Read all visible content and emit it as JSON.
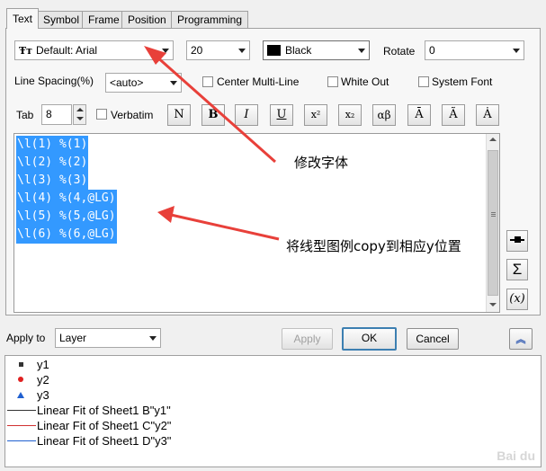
{
  "tabs": [
    {
      "label": "Text",
      "active": true
    },
    {
      "label": "Symbol",
      "active": false
    },
    {
      "label": "Frame",
      "active": false
    },
    {
      "label": "Position",
      "active": false
    },
    {
      "label": "Programming",
      "active": false
    }
  ],
  "font": {
    "icon": "truetype-font-icon",
    "value": "Default: Arial"
  },
  "size": {
    "value": "20"
  },
  "color": {
    "value": "Black",
    "swatch": "#000000"
  },
  "rotate": {
    "label": "Rotate",
    "value": "0"
  },
  "line_spacing": {
    "label": "Line Spacing(%)",
    "value": "<auto>"
  },
  "center_multiline": {
    "label": "Center Multi-Line",
    "checked": false
  },
  "white_out": {
    "label": "White Out",
    "checked": false
  },
  "system_font": {
    "label": "System Font",
    "checked": false
  },
  "tab": {
    "label": "Tab",
    "value": "8"
  },
  "verbatim": {
    "label": "Verbatim",
    "checked": false
  },
  "format_buttons": [
    "N",
    "B",
    "I",
    "U",
    "x²",
    "x₂",
    "αβ",
    "Ā",
    "Ã",
    "Ȧ"
  ],
  "editor_lines": [
    "\\l(1) %(1)",
    "\\l(2) %(2)",
    "\\l(3) %(3)",
    "\\l(4) %(4,@LG)",
    "\\l(5) %(5,@LG)",
    "\\l(6) %(6,@LG)"
  ],
  "side_buttons": [
    "⊸",
    "Σ",
    "(x)"
  ],
  "apply_to": {
    "label": "Apply to",
    "value": "Layer"
  },
  "buttons": {
    "apply": "Apply",
    "ok": "OK",
    "cancel": "Cancel"
  },
  "legend_items": [
    {
      "marker": "square",
      "text": "y1",
      "color": "#333333"
    },
    {
      "marker": "circle",
      "text": "y2",
      "color": "#e02020"
    },
    {
      "marker": "triangle",
      "text": "y3",
      "color": "#2060d0"
    },
    {
      "marker": "line",
      "text": "Linear Fit of Sheet1 B\"y1\"",
      "color": "#333333"
    },
    {
      "marker": "line",
      "text": "Linear Fit of Sheet1 C\"y2\"",
      "color": "#d03030"
    },
    {
      "marker": "line",
      "text": "Linear Fit of Sheet1 D\"y3\"",
      "color": "#2060d0"
    }
  ],
  "annotations": {
    "font_change": "修改字体",
    "legend_copy": "将线型图例copy到相应y位置"
  },
  "arrow_color": "#e8403a"
}
